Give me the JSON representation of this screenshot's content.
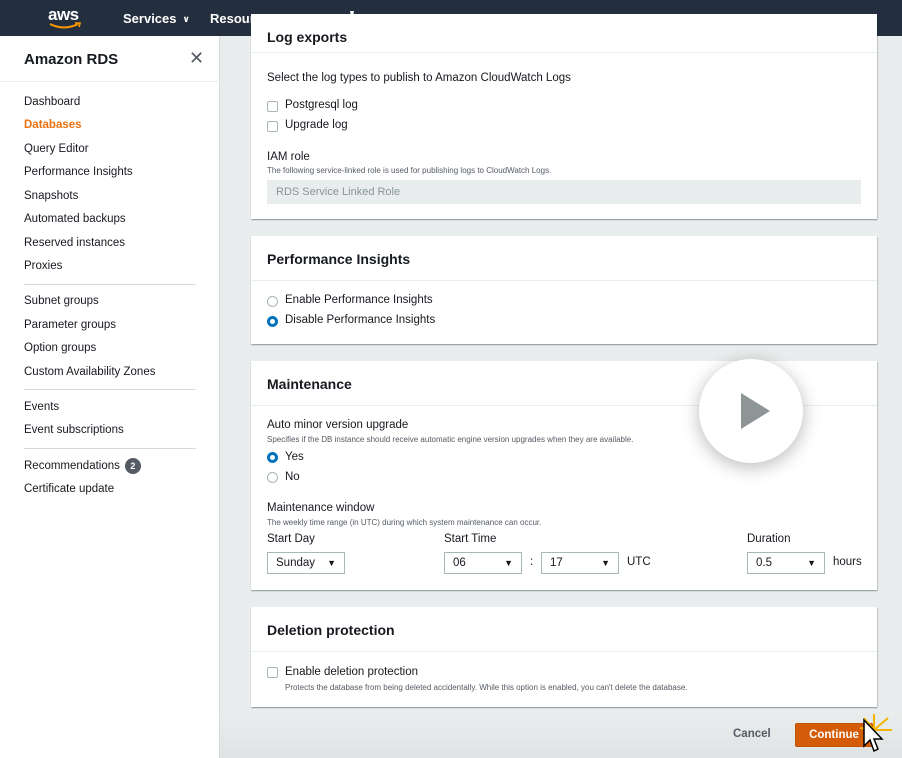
{
  "topnav": {
    "logo": "aws",
    "services": "Services",
    "resource_groups": "Resource Groups",
    "pin_icon": "pin-icon"
  },
  "sidebar": {
    "title": "Amazon RDS",
    "close_icon": "close-icon",
    "group1": [
      "Dashboard",
      "Databases",
      "Query Editor",
      "Performance Insights",
      "Snapshots",
      "Automated backups",
      "Reserved instances",
      "Proxies"
    ],
    "group2": [
      "Subnet groups",
      "Parameter groups",
      "Option groups",
      "Custom Availability Zones"
    ],
    "group3": [
      "Events",
      "Event subscriptions"
    ],
    "recommendations": {
      "label": "Recommendations",
      "count": "2"
    },
    "certificate_update": "Certificate update",
    "active": "Databases",
    "active_color": "#ec7211"
  },
  "log_exports": {
    "title": "Log exports",
    "description": "Select the log types to publish to Amazon CloudWatch Logs",
    "options": [
      {
        "label": "Postgresql log",
        "checked": false
      },
      {
        "label": "Upgrade log",
        "checked": false
      }
    ],
    "iam_role_label": "IAM role",
    "iam_role_description": "The following service-linked role is used for publishing logs to CloudWatch Logs.",
    "iam_role_value": "RDS Service Linked Role"
  },
  "performance_insights": {
    "title": "Performance Insights",
    "options": [
      {
        "label": "Enable Performance Insights",
        "selected": false
      },
      {
        "label": "Disable Performance Insights",
        "selected": true
      }
    ]
  },
  "maintenance": {
    "title": "Maintenance",
    "auto_minor_label": "Auto minor version upgrade",
    "auto_minor_description": "Specifies if the DB instance should receive automatic engine version upgrades when they are available.",
    "auto_minor_options": [
      {
        "label": "Yes",
        "selected": true
      },
      {
        "label": "No",
        "selected": false
      }
    ],
    "window_label": "Maintenance window",
    "window_description": "The weekly time range (in UTC) during which system maintenance can occur.",
    "start_day_label": "Start Day",
    "start_day_value": "Sunday",
    "start_time_label": "Start Time",
    "start_hour": "06",
    "time_separator": ":",
    "start_minute": "17",
    "timezone": "UTC",
    "duration_label": "Duration",
    "duration_value": "0.5",
    "duration_unit": "hours"
  },
  "deletion_protection": {
    "title": "Deletion protection",
    "checkbox_label": "Enable deletion protection",
    "checked": false,
    "description": "Protects the database from being deleted accidentally. While this option is enabled, you can't delete the database."
  },
  "footer": {
    "cancel": "Cancel",
    "continue": "Continue",
    "primary_color": "#d45b07"
  },
  "overlay": {
    "play_icon": "play-icon"
  }
}
